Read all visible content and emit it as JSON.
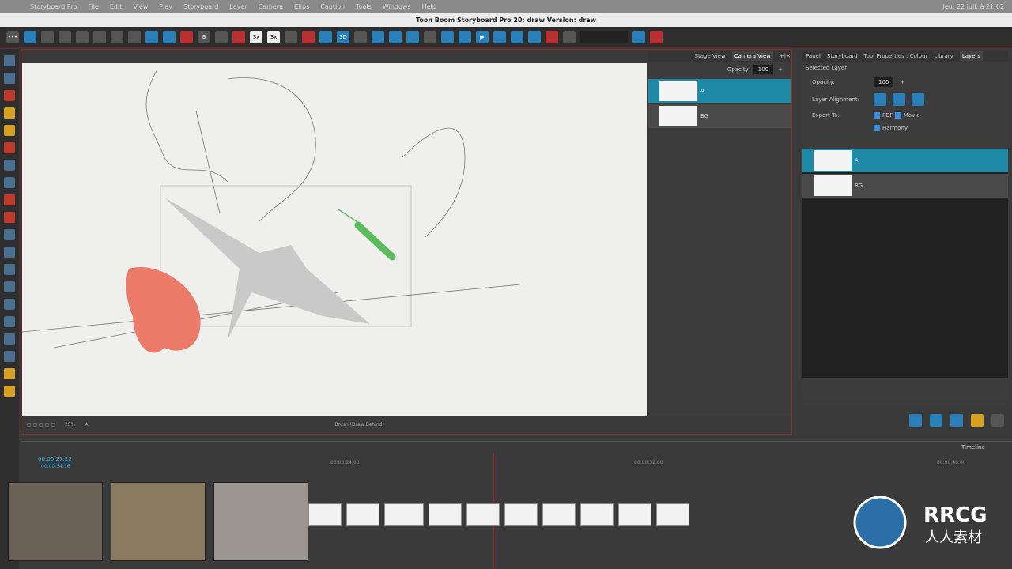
{
  "menubar": {
    "app": "Storyboard Pro",
    "items": [
      "File",
      "Edit",
      "View",
      "Play",
      "Storyboard",
      "Layer",
      "Camera",
      "Clips",
      "Caption",
      "Tools",
      "Windows",
      "Help"
    ],
    "clock": "Jeu. 22 juil. à 21:02"
  },
  "window": {
    "title": "Toon Boom Storyboard Pro 20: draw Version: draw"
  },
  "toolbar": {
    "zoom_3x_a": "3x",
    "zoom_3x_b": "3x",
    "label_3d": "3D"
  },
  "camera_view": {
    "tabs": [
      "Stage View",
      "Camera View"
    ],
    "opacity_label": "Opacity",
    "opacity": "100",
    "layers": [
      {
        "name": "A",
        "selected": true
      },
      {
        "name": "BG",
        "selected": false
      }
    ]
  },
  "canvas_status": {
    "zoom": "25%",
    "layer": "A",
    "tool": "Brush (Draw Behind)"
  },
  "layers_panel": {
    "tabs": [
      "Panel",
      "Storyboard",
      "Tool Properties : Colour",
      "Library",
      "Layers"
    ],
    "section": "Selected Layer",
    "opacity_label": "Opacity:",
    "opacity": "100",
    "alignment_label": "Layer Alignment:",
    "export_label": "Export To:",
    "export": {
      "pdf": "PDF",
      "movie": "Movie",
      "harmony": "Harmony"
    },
    "layers": [
      {
        "name": "A",
        "selected": true
      },
      {
        "name": "BG",
        "selected": false
      }
    ]
  },
  "timeline": {
    "title": "Timeline",
    "current": "00:00:27:22",
    "total": "00:00:34:16",
    "ticks": [
      "00:00:24:00",
      "00:00:32:00",
      "00:00:40:00"
    ]
  },
  "watermark": {
    "logo": "RRCG",
    "sub": "人人素材"
  },
  "colors": {
    "accent": "#1f8aa8",
    "playhead": "#b02020",
    "timecode": "#3ab0e8"
  }
}
